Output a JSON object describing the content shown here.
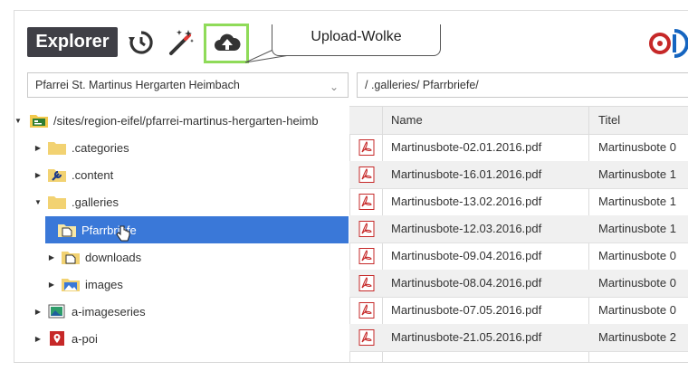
{
  "toolbar": {
    "explorer_label": "Explorer",
    "history_icon": "history-icon",
    "magic_icon": "magic-wand-icon",
    "upload_icon": "cloud-upload-icon",
    "callout_text": "Upload-Wolke",
    "accent_green": "#8fdb59"
  },
  "site_select": {
    "value": "Pfarrei St. Martinus Hergarten Heimbach"
  },
  "path_field": {
    "value": "/ .galleries/ Pfarrbriefe/"
  },
  "tree": {
    "items": [
      {
        "label": "/sites/region-eifel/pfarrei-martinus-hergarten-heimb",
        "icon": "site-icon",
        "expanded": true
      },
      {
        "label": ".categories",
        "icon": "folder-icon",
        "expanded": false
      },
      {
        "label": ".content",
        "icon": "wrench-folder-icon",
        "expanded": false
      },
      {
        "label": ".galleries",
        "icon": "folder-icon",
        "expanded": true
      },
      {
        "label": "Pfarrbriefe",
        "icon": "file-folder-icon",
        "selected": true
      },
      {
        "label": "downloads",
        "icon": "file-folder-icon",
        "expanded": false
      },
      {
        "label": "images",
        "icon": "image-folder-icon",
        "expanded": false
      },
      {
        "label": "a-imageseries",
        "icon": "image-series-icon",
        "expanded": false
      },
      {
        "label": "a-poi",
        "icon": "poi-icon",
        "expanded": false
      }
    ],
    "selected_color": "#3a78d8"
  },
  "table": {
    "columns": [
      "Name",
      "Titel"
    ],
    "rows": [
      {
        "name": "Martinusbote-02.01.2016.pdf",
        "title": "Martinusbote 0"
      },
      {
        "name": "Martinusbote-16.01.2016.pdf",
        "title": "Martinusbote 1"
      },
      {
        "name": "Martinusbote-13.02.2016.pdf",
        "title": "Martinusbote 1"
      },
      {
        "name": "Martinusbote-12.03.2016.pdf",
        "title": "Martinusbote 1"
      },
      {
        "name": "Martinusbote-09.04.2016.pdf",
        "title": "Martinusbote 0"
      },
      {
        "name": "Martinusbote-08.04.2016.pdf",
        "title": "Martinusbote 0"
      },
      {
        "name": "Martinusbote-07.05.2016.pdf",
        "title": "Martinusbote 0"
      },
      {
        "name": "Martinusbote-21.05.2016.pdf",
        "title": "Martinusbote 2"
      }
    ]
  }
}
